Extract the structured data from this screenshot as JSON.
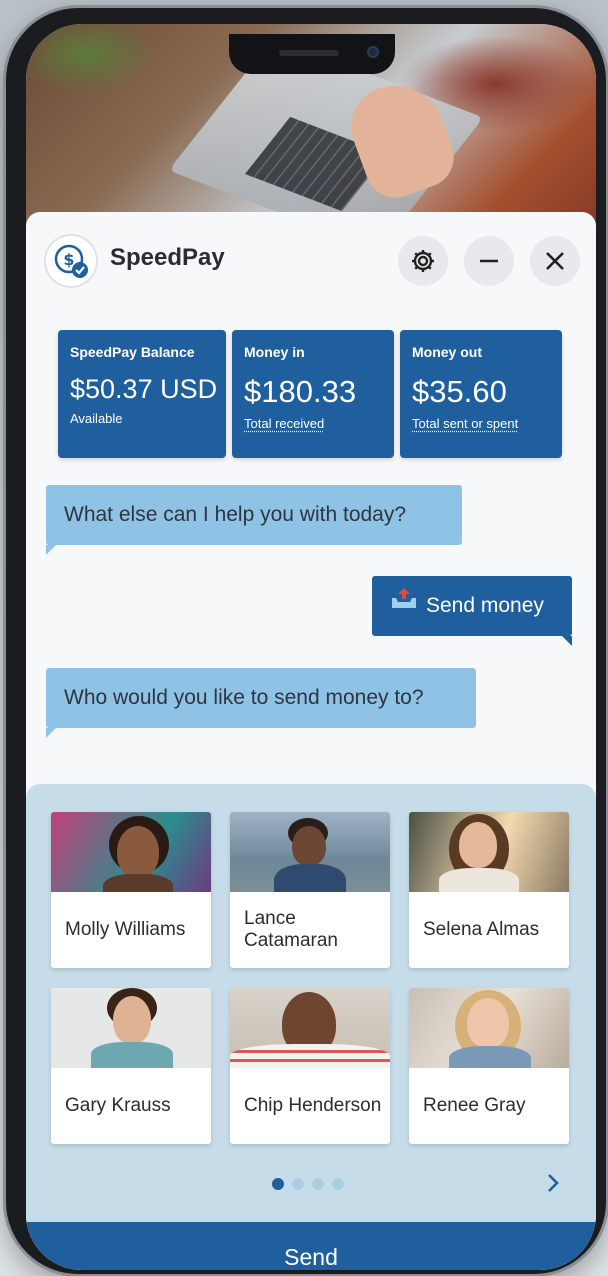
{
  "app": {
    "name": "SpeedPay",
    "accent": "#1f5f9e",
    "bubble_color": "#8fc3e6"
  },
  "header": {
    "logo_icon": "dollar-check-icon",
    "icons": [
      "gear-icon",
      "minimize-icon",
      "close-icon"
    ]
  },
  "balances": [
    {
      "title": "SpeedPay Balance",
      "value": "$50.37 USD",
      "sub": "Available"
    },
    {
      "title": "Money in",
      "value": "$180.33",
      "sub": "Total received"
    },
    {
      "title": "Money out",
      "value": "$35.60",
      "sub": "Total sent or spent"
    }
  ],
  "chat": {
    "bot_message_1": "What else can I help you with today?",
    "user_message": "Send money",
    "user_message_icon": "send-tray-icon",
    "bot_message_2": "Who would you like to send money to?"
  },
  "contacts": [
    {
      "name": "Molly Williams"
    },
    {
      "name": "Lance Catamaran"
    },
    {
      "name": "Selena Almas"
    },
    {
      "name": "Gary Krauss"
    },
    {
      "name": "Chip Henderson"
    },
    {
      "name": "Renee Gray"
    }
  ],
  "pagination": {
    "current_page": 1,
    "total_pages": 4,
    "next_icon": "chevron-right-icon"
  },
  "footer": {
    "send_label": "Send"
  }
}
